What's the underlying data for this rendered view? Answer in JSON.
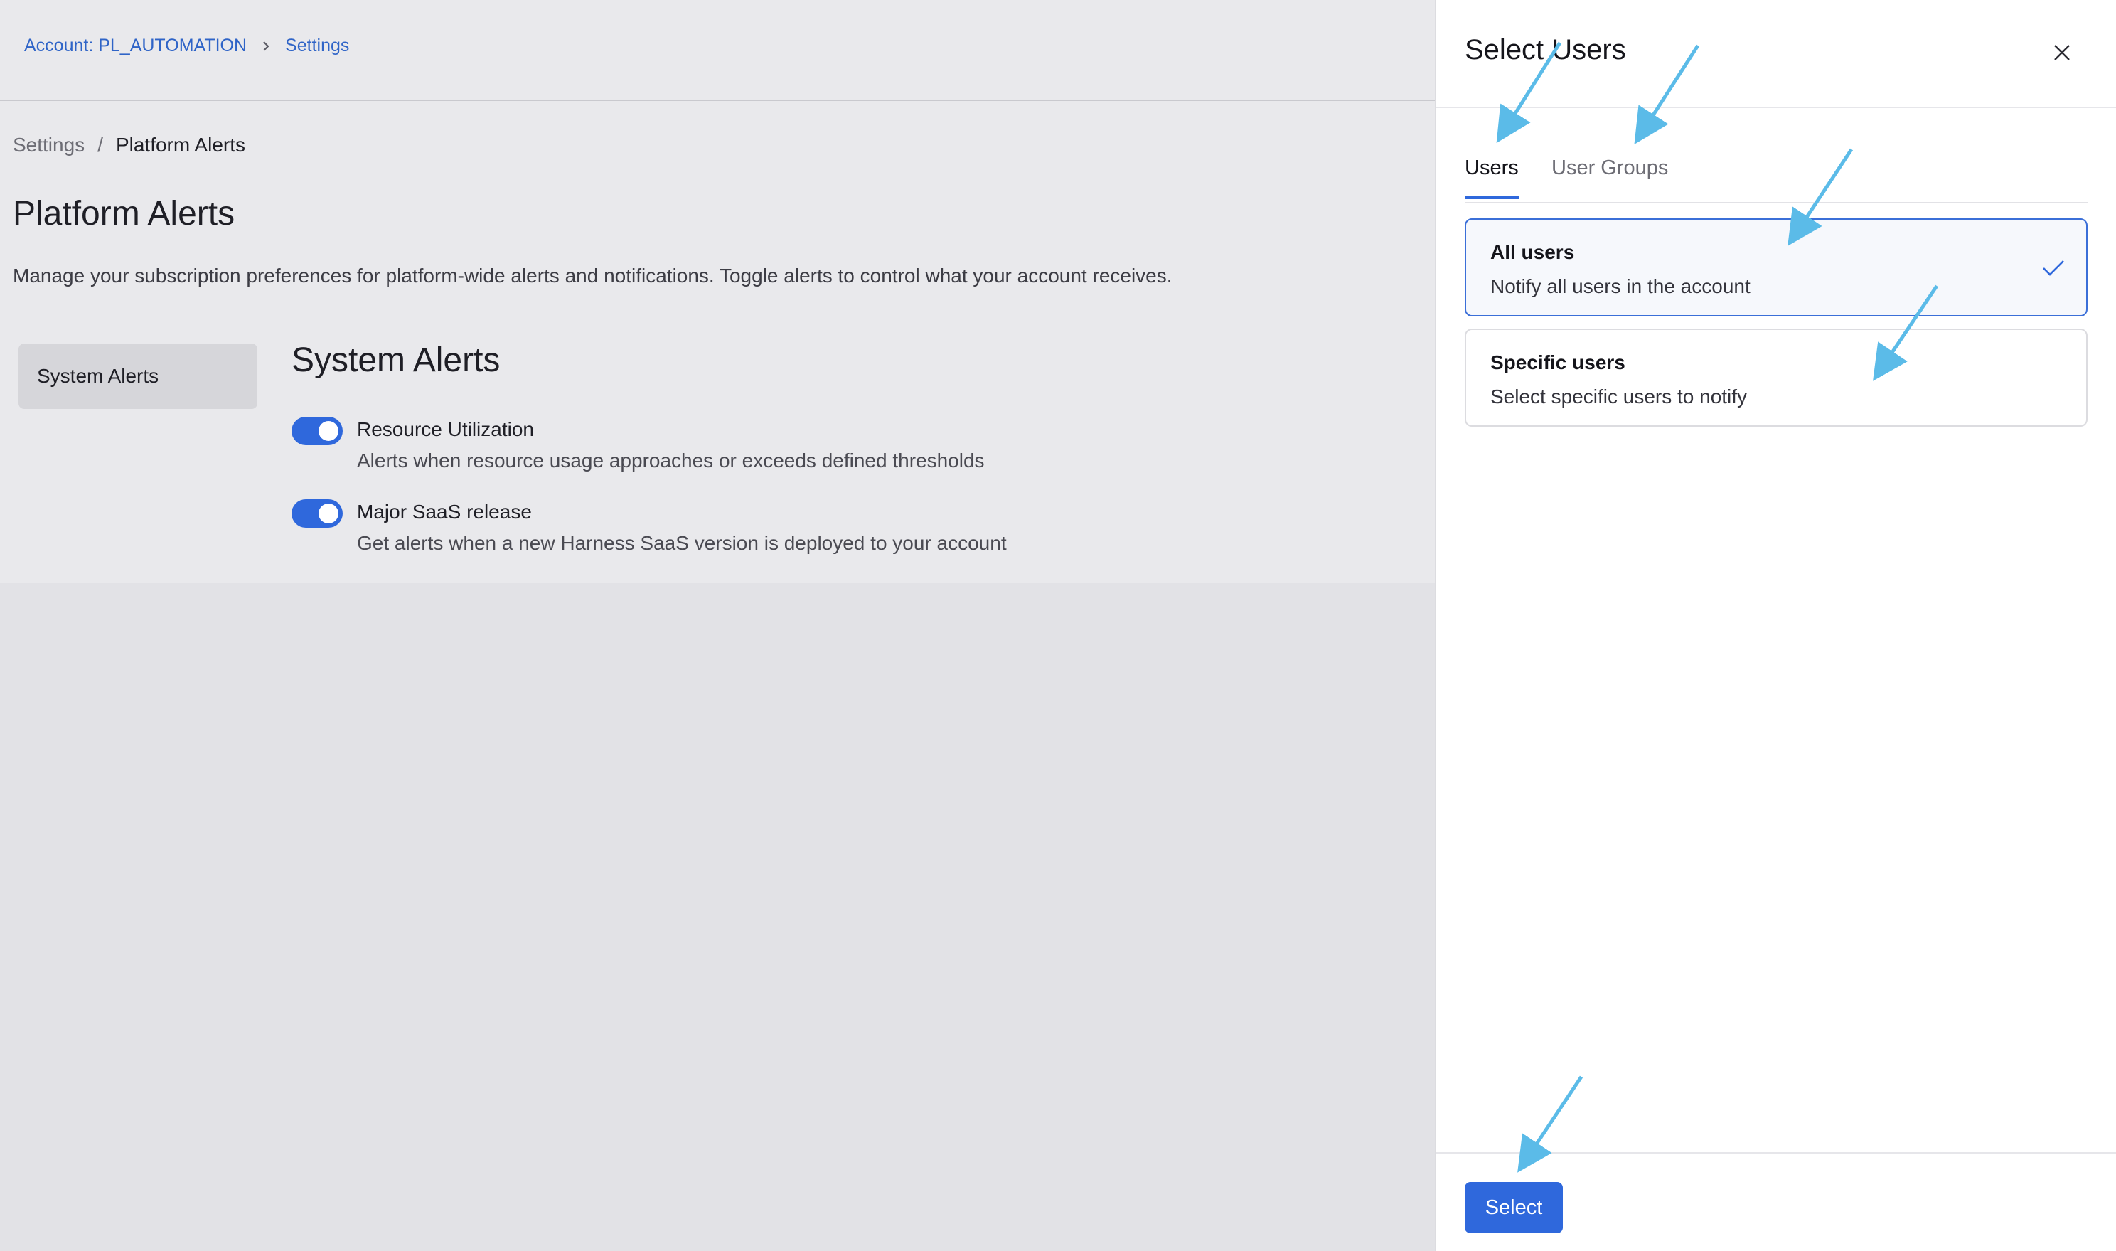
{
  "breadcrumb_top": {
    "account": "Account: PL_AUTOMATION",
    "settings": "Settings"
  },
  "breadcrumb": {
    "root": "Settings",
    "separator": "/",
    "current": "Platform Alerts"
  },
  "page": {
    "title": "Platform Alerts",
    "description": "Manage your subscription preferences for platform-wide alerts and notifications. Toggle alerts to control what your account receives."
  },
  "sidebar": {
    "items": [
      {
        "label": "System Alerts",
        "active": true
      }
    ]
  },
  "section": {
    "title": "System Alerts",
    "alerts": [
      {
        "name": "Resource Utilization",
        "description": "Alerts when resource usage approaches or exceeds defined thresholds",
        "enabled": true
      },
      {
        "name": "Major SaaS release",
        "description": "Get alerts when a new Harness SaaS version is deployed to your account",
        "enabled": true
      }
    ]
  },
  "panel": {
    "title": "Select Users",
    "tabs": [
      {
        "label": "Users",
        "active": true
      },
      {
        "label": "User Groups",
        "active": false
      }
    ],
    "options": [
      {
        "title": "All users",
        "subtitle": "Notify all users in the account",
        "selected": true
      },
      {
        "title": "Specific users",
        "subtitle": "Select specific users to notify",
        "selected": false
      }
    ],
    "select_label": "Select"
  },
  "colors": {
    "accent": "#2f68dc",
    "link": "#2f64c7",
    "annotation_arrow": "#5bbbe8"
  },
  "icons": {
    "close": "close-icon",
    "check": "check-icon",
    "chevron": "chevron-right-icon"
  }
}
